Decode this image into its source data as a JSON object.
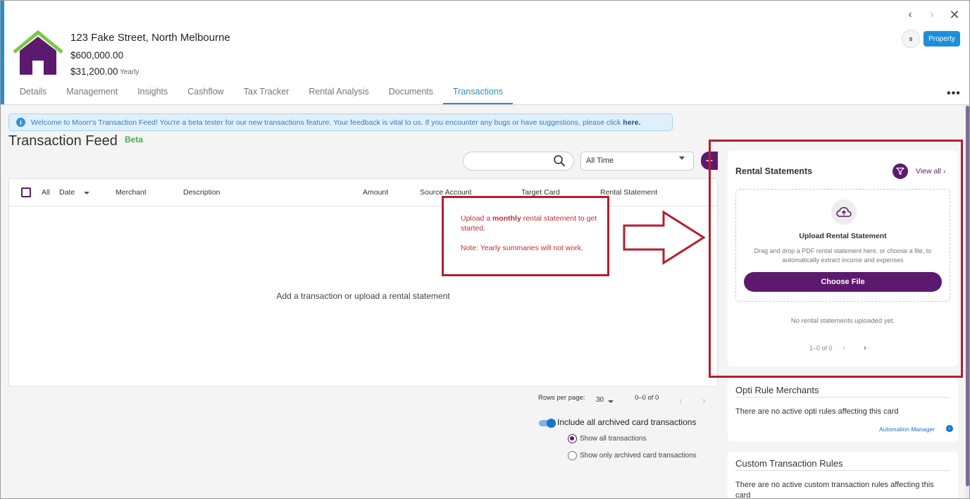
{
  "property": {
    "address": "123 Fake Street, North Melbourne",
    "value": "$600,000.00",
    "rent": "$31,200.00",
    "rent_period": "Yearly",
    "avatar_initial": "s",
    "type_badge": "Property"
  },
  "nav": {
    "prev": "‹",
    "next": "›",
    "close": "✕"
  },
  "tabs": [
    {
      "label": "Details"
    },
    {
      "label": "Management"
    },
    {
      "label": "Insights"
    },
    {
      "label": "Cashflow"
    },
    {
      "label": "Tax Tracker"
    },
    {
      "label": "Rental Analysis"
    },
    {
      "label": "Documents"
    },
    {
      "label": "Transactions",
      "active": true
    }
  ],
  "more_menu": "•••",
  "banner": {
    "text": "Welcome to Moorr's Transaction Feed! You're a beta tester for our new transactions feature. Your feedback is vital to us. If you encounter any bugs or have suggestions, please click",
    "link": "here."
  },
  "feed": {
    "title": "Transaction Feed",
    "badge": "Beta",
    "search_placeholder": "",
    "period": "All Time",
    "add_label": "+"
  },
  "table": {
    "columns": [
      "All",
      "Date",
      "Merchant",
      "Description",
      "Amount",
      "Source Account",
      "Target Card",
      "Rental Statement"
    ],
    "empty_message": "Add a transaction or upload a rental statement"
  },
  "annotation": {
    "line1_prefix": "Upload a ",
    "line1_bold": "monthly",
    "line1_suffix": " rental statement to get started.",
    "line2": "Note: Yearly summaries will not work.",
    "color": "#b51e2c"
  },
  "pagination": {
    "rows_label": "Rows per page:",
    "rows_value": "30",
    "range": "0–0 of 0",
    "prev": "‹",
    "next": "›"
  },
  "archived": {
    "toggle_label": "Include all archived card transactions",
    "toggle_on": true,
    "options": [
      {
        "label": "Show all transactions",
        "checked": true
      },
      {
        "label": "Show only archived card transactions",
        "checked": false
      }
    ]
  },
  "rental_statements": {
    "title": "Rental Statements",
    "view_all": "View all ›",
    "upload_title": "Upload Rental Statement",
    "upload_desc": "Drag and drop a PDF rental statement here, or choose a file, to automatically extract income and expenses",
    "choose_button": "Choose File",
    "empty": "No rental statements uploaded yet.",
    "range": "1–0 of 0",
    "prev": "‹",
    "next": "›"
  },
  "opti_rules": {
    "title": "Opti Rule Merchants",
    "text": "There are no active opti rules affecting this card",
    "link": "Automation Manager",
    "link_icon": "i"
  },
  "custom_rules": {
    "title": "Custom Transaction Rules",
    "text": "There are no active custom transaction rules affecting this card"
  },
  "colors": {
    "brand_purple": "#5c1a6e",
    "accent_blue": "#1e8fd6",
    "house_green": "#7ac943",
    "beta_green": "#39b54a"
  },
  "icons": {
    "house": "house-logo-icon",
    "search": "search-icon",
    "filter": "filter-icon",
    "upload": "cloud-upload-icon",
    "info": "info-icon"
  }
}
